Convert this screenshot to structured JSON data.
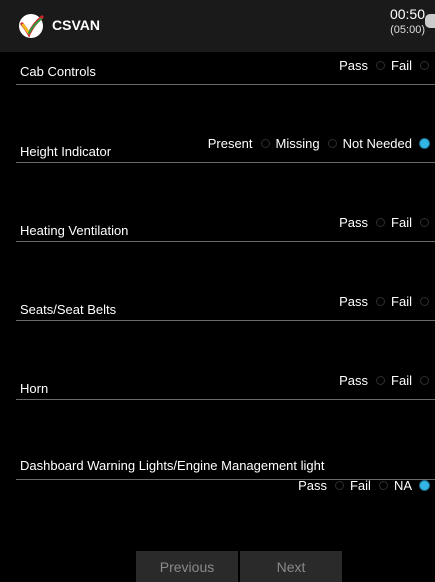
{
  "header": {
    "title": "CSVAN",
    "time": "00:50",
    "time_total": "(05:00)"
  },
  "items": [
    {
      "label": "Cab Controls",
      "options": [
        {
          "label": "Pass",
          "checked": false
        },
        {
          "label": "Fail",
          "checked": false
        }
      ]
    },
    {
      "label": "Height Indicator",
      "options": [
        {
          "label": "Present",
          "checked": false
        },
        {
          "label": "Missing",
          "checked": false
        },
        {
          "label": "Not Needed",
          "checked": true
        }
      ]
    },
    {
      "label": "Heating Ventilation",
      "options": [
        {
          "label": "Pass",
          "checked": false
        },
        {
          "label": "Fail",
          "checked": false
        }
      ]
    },
    {
      "label": "Seats/Seat Belts",
      "options": [
        {
          "label": "Pass",
          "checked": false
        },
        {
          "label": "Fail",
          "checked": false
        }
      ]
    },
    {
      "label": "Horn",
      "options": [
        {
          "label": "Pass",
          "checked": false
        },
        {
          "label": "Fail",
          "checked": false
        }
      ]
    },
    {
      "label": "Dashboard Warning Lights/Engine Management light",
      "options": [
        {
          "label": "Pass",
          "checked": false
        },
        {
          "label": "Fail",
          "checked": false
        },
        {
          "label": "NA",
          "checked": true
        }
      ]
    }
  ],
  "nav": {
    "previous": "Previous",
    "next": "Next"
  },
  "colors": {
    "accent": "#33b5e5",
    "background": "#000000",
    "header": "#1a1a1a"
  }
}
